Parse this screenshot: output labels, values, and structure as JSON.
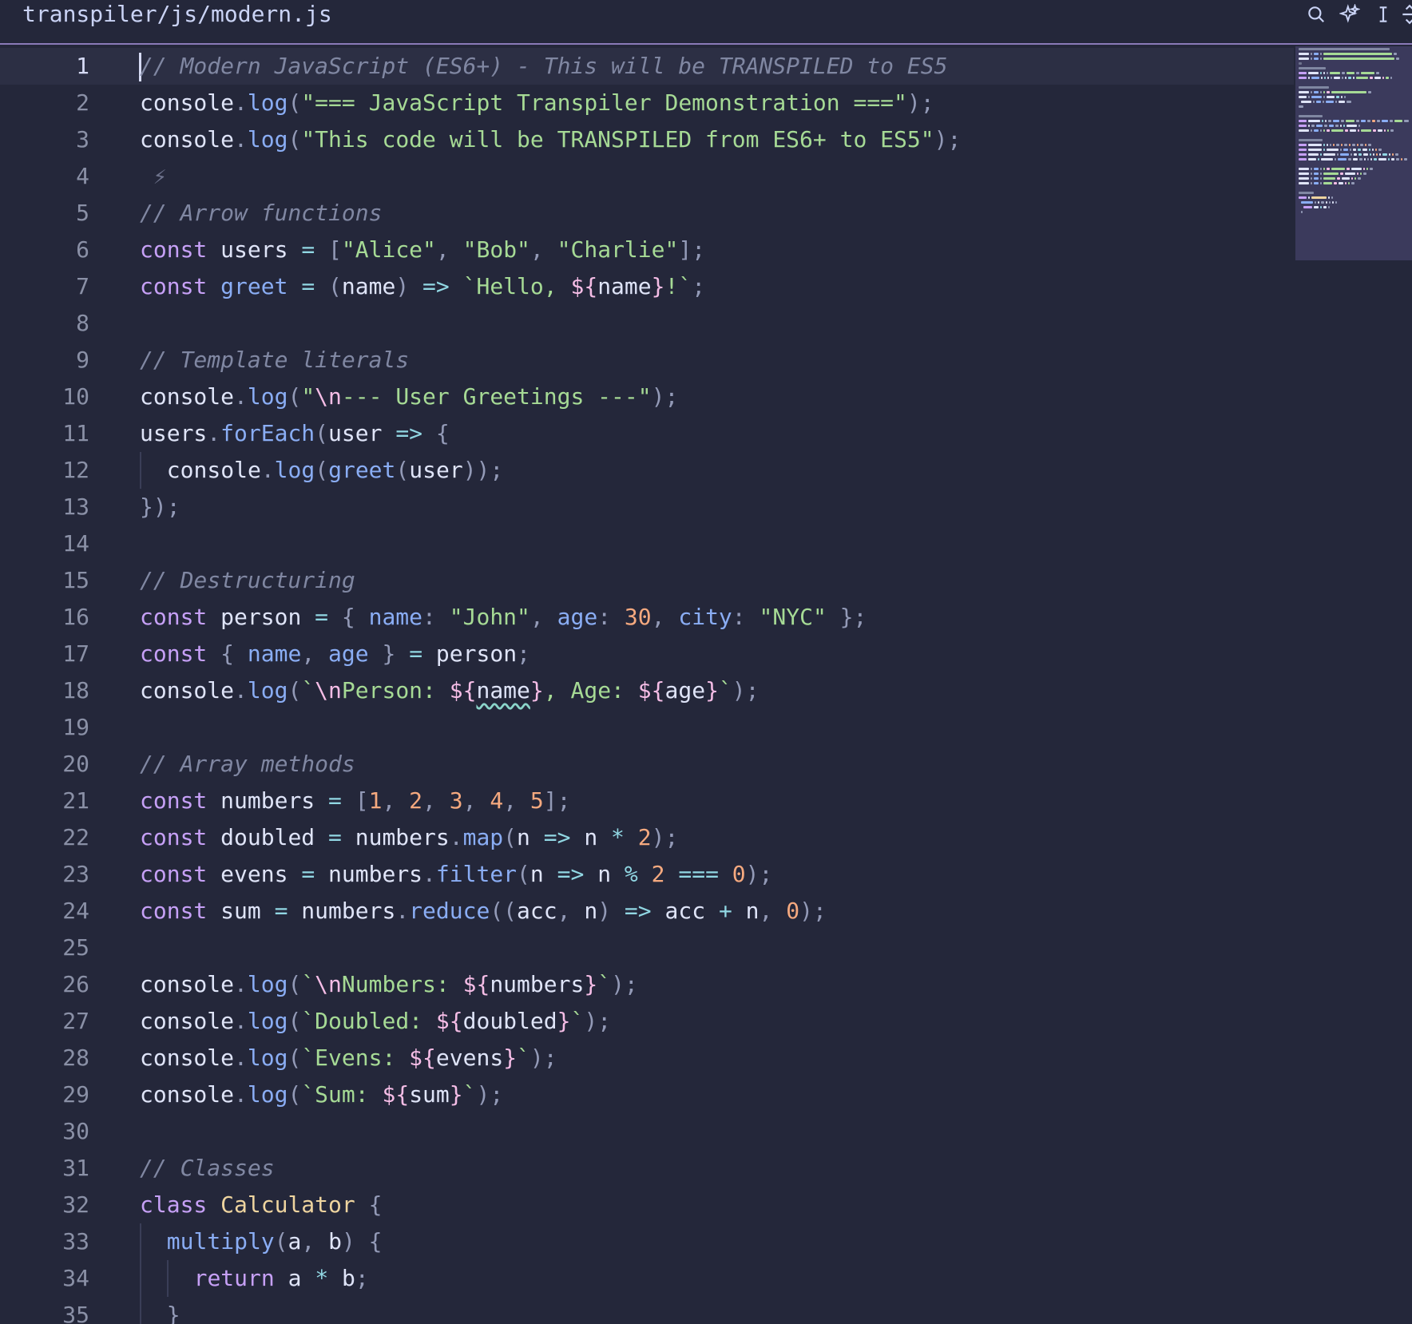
{
  "header": {
    "file_path": "transpiler/js/modern.js",
    "icons": [
      "search-icon",
      "sparkle-icon",
      "text-cursor-icon",
      "split-icon"
    ]
  },
  "editor": {
    "current_line": 1,
    "lines": [
      {
        "n": "1",
        "indent": 0,
        "tokens": [
          [
            "comment",
            "// Modern JavaScript (ES6+) - This will be TRANSPILED to ES5"
          ]
        ]
      },
      {
        "n": "2",
        "indent": 0,
        "tokens": [
          [
            "plain",
            "console"
          ],
          [
            "punct",
            "."
          ],
          [
            "function",
            "log"
          ],
          [
            "punct",
            "("
          ],
          [
            "string",
            "\"=== JavaScript Transpiler Demonstration ===\""
          ],
          [
            "punct",
            ");"
          ]
        ]
      },
      {
        "n": "3",
        "indent": 0,
        "tokens": [
          [
            "plain",
            "console"
          ],
          [
            "punct",
            "."
          ],
          [
            "function",
            "log"
          ],
          [
            "punct",
            "("
          ],
          [
            "string",
            "\"This code will be TRANSPILED from ES6+ to ES5\""
          ],
          [
            "punct",
            ");"
          ]
        ]
      },
      {
        "n": "4",
        "indent": 0,
        "tokens": [
          [
            "hint",
            " ⚡"
          ]
        ]
      },
      {
        "n": "5",
        "indent": 0,
        "tokens": [
          [
            "comment",
            "// Arrow functions"
          ]
        ]
      },
      {
        "n": "6",
        "indent": 0,
        "tokens": [
          [
            "keyword",
            "const"
          ],
          [
            "plain",
            " users "
          ],
          [
            "operator",
            "="
          ],
          [
            "plain",
            " "
          ],
          [
            "punct",
            "["
          ],
          [
            "string",
            "\"Alice\""
          ],
          [
            "punct",
            ", "
          ],
          [
            "string",
            "\"Bob\""
          ],
          [
            "punct",
            ", "
          ],
          [
            "string",
            "\"Charlie\""
          ],
          [
            "punct",
            "];"
          ]
        ]
      },
      {
        "n": "7",
        "indent": 0,
        "tokens": [
          [
            "keyword",
            "const"
          ],
          [
            "plain",
            " "
          ],
          [
            "function",
            "greet"
          ],
          [
            "plain",
            " "
          ],
          [
            "operator",
            "="
          ],
          [
            "plain",
            " "
          ],
          [
            "punct",
            "("
          ],
          [
            "plain",
            "name"
          ],
          [
            "punct",
            ")"
          ],
          [
            "plain",
            " "
          ],
          [
            "operator",
            "=>"
          ],
          [
            "plain",
            " "
          ],
          [
            "string",
            "`Hello, "
          ],
          [
            "interp",
            "${"
          ],
          [
            "plain",
            "name"
          ],
          [
            "interp",
            "}"
          ],
          [
            "string",
            "!`"
          ],
          [
            "punct",
            ";"
          ]
        ]
      },
      {
        "n": "8",
        "indent": 0,
        "tokens": []
      },
      {
        "n": "9",
        "indent": 0,
        "tokens": [
          [
            "comment",
            "// Template literals"
          ]
        ]
      },
      {
        "n": "10",
        "indent": 0,
        "tokens": [
          [
            "plain",
            "console"
          ],
          [
            "punct",
            "."
          ],
          [
            "function",
            "log"
          ],
          [
            "punct",
            "("
          ],
          [
            "string",
            "\""
          ],
          [
            "escape",
            "\\n"
          ],
          [
            "string",
            "--- User Greetings ---\""
          ],
          [
            "punct",
            ");"
          ]
        ]
      },
      {
        "n": "11",
        "indent": 0,
        "tokens": [
          [
            "plain",
            "users"
          ],
          [
            "punct",
            "."
          ],
          [
            "function",
            "forEach"
          ],
          [
            "punct",
            "("
          ],
          [
            "plain",
            "user "
          ],
          [
            "operator",
            "=>"
          ],
          [
            "plain",
            " "
          ],
          [
            "punct",
            "{"
          ]
        ]
      },
      {
        "n": "12",
        "indent": 1,
        "tokens": [
          [
            "plain",
            "console"
          ],
          [
            "punct",
            "."
          ],
          [
            "function",
            "log"
          ],
          [
            "punct",
            "("
          ],
          [
            "function",
            "greet"
          ],
          [
            "punct",
            "("
          ],
          [
            "plain",
            "user"
          ],
          [
            "punct",
            "));"
          ]
        ]
      },
      {
        "n": "13",
        "indent": 0,
        "tokens": [
          [
            "punct",
            "});"
          ]
        ]
      },
      {
        "n": "14",
        "indent": 0,
        "tokens": []
      },
      {
        "n": "15",
        "indent": 0,
        "tokens": [
          [
            "comment",
            "// Destructuring"
          ]
        ]
      },
      {
        "n": "16",
        "indent": 0,
        "tokens": [
          [
            "keyword",
            "const"
          ],
          [
            "plain",
            " person "
          ],
          [
            "operator",
            "="
          ],
          [
            "plain",
            " "
          ],
          [
            "punct",
            "{ "
          ],
          [
            "property",
            "name"
          ],
          [
            "punct",
            ": "
          ],
          [
            "string",
            "\"John\""
          ],
          [
            "punct",
            ", "
          ],
          [
            "property",
            "age"
          ],
          [
            "punct",
            ": "
          ],
          [
            "number",
            "30"
          ],
          [
            "punct",
            ", "
          ],
          [
            "property",
            "city"
          ],
          [
            "punct",
            ": "
          ],
          [
            "string",
            "\"NYC\""
          ],
          [
            "punct",
            " };"
          ]
        ]
      },
      {
        "n": "17",
        "indent": 0,
        "tokens": [
          [
            "keyword",
            "const"
          ],
          [
            "plain",
            " "
          ],
          [
            "punct",
            "{ "
          ],
          [
            "property",
            "name"
          ],
          [
            "punct",
            ", "
          ],
          [
            "property",
            "age"
          ],
          [
            "punct",
            " }"
          ],
          [
            "plain",
            " "
          ],
          [
            "operator",
            "="
          ],
          [
            "plain",
            " person"
          ],
          [
            "punct",
            ";"
          ]
        ]
      },
      {
        "n": "18",
        "indent": 0,
        "tokens": [
          [
            "plain",
            "console"
          ],
          [
            "punct",
            "."
          ],
          [
            "function",
            "log"
          ],
          [
            "punct",
            "("
          ],
          [
            "string",
            "`"
          ],
          [
            "escape",
            "\\n"
          ],
          [
            "string",
            "Person: "
          ],
          [
            "interp",
            "${"
          ],
          [
            "squiggle",
            "name"
          ],
          [
            "interp",
            "}"
          ],
          [
            "string",
            ", Age: "
          ],
          [
            "interp",
            "${"
          ],
          [
            "plain",
            "age"
          ],
          [
            "interp",
            "}"
          ],
          [
            "string",
            "`"
          ],
          [
            "punct",
            ");"
          ]
        ]
      },
      {
        "n": "19",
        "indent": 0,
        "tokens": []
      },
      {
        "n": "20",
        "indent": 0,
        "tokens": [
          [
            "comment",
            "// Array methods"
          ]
        ]
      },
      {
        "n": "21",
        "indent": 0,
        "tokens": [
          [
            "keyword",
            "const"
          ],
          [
            "plain",
            " numbers "
          ],
          [
            "operator",
            "="
          ],
          [
            "plain",
            " "
          ],
          [
            "punct",
            "["
          ],
          [
            "number",
            "1"
          ],
          [
            "punct",
            ", "
          ],
          [
            "number",
            "2"
          ],
          [
            "punct",
            ", "
          ],
          [
            "number",
            "3"
          ],
          [
            "punct",
            ", "
          ],
          [
            "number",
            "4"
          ],
          [
            "punct",
            ", "
          ],
          [
            "number",
            "5"
          ],
          [
            "punct",
            "];"
          ]
        ]
      },
      {
        "n": "22",
        "indent": 0,
        "tokens": [
          [
            "keyword",
            "const"
          ],
          [
            "plain",
            " doubled "
          ],
          [
            "operator",
            "="
          ],
          [
            "plain",
            " numbers"
          ],
          [
            "punct",
            "."
          ],
          [
            "function",
            "map"
          ],
          [
            "punct",
            "("
          ],
          [
            "plain",
            "n "
          ],
          [
            "operator",
            "=>"
          ],
          [
            "plain",
            " n "
          ],
          [
            "operator",
            "*"
          ],
          [
            "plain",
            " "
          ],
          [
            "number",
            "2"
          ],
          [
            "punct",
            ");"
          ]
        ]
      },
      {
        "n": "23",
        "indent": 0,
        "tokens": [
          [
            "keyword",
            "const"
          ],
          [
            "plain",
            " evens "
          ],
          [
            "operator",
            "="
          ],
          [
            "plain",
            " numbers"
          ],
          [
            "punct",
            "."
          ],
          [
            "function",
            "filter"
          ],
          [
            "punct",
            "("
          ],
          [
            "plain",
            "n "
          ],
          [
            "operator",
            "=>"
          ],
          [
            "plain",
            " n "
          ],
          [
            "operator",
            "%"
          ],
          [
            "plain",
            " "
          ],
          [
            "number",
            "2"
          ],
          [
            "plain",
            " "
          ],
          [
            "operator",
            "==="
          ],
          [
            "plain",
            " "
          ],
          [
            "number",
            "0"
          ],
          [
            "punct",
            ");"
          ]
        ]
      },
      {
        "n": "24",
        "indent": 0,
        "tokens": [
          [
            "keyword",
            "const"
          ],
          [
            "plain",
            " sum "
          ],
          [
            "operator",
            "="
          ],
          [
            "plain",
            " numbers"
          ],
          [
            "punct",
            "."
          ],
          [
            "function",
            "reduce"
          ],
          [
            "punct",
            "(("
          ],
          [
            "plain",
            "acc"
          ],
          [
            "punct",
            ", "
          ],
          [
            "plain",
            "n"
          ],
          [
            "punct",
            ")"
          ],
          [
            "plain",
            " "
          ],
          [
            "operator",
            "=>"
          ],
          [
            "plain",
            " acc "
          ],
          [
            "operator",
            "+"
          ],
          [
            "plain",
            " n"
          ],
          [
            "punct",
            ", "
          ],
          [
            "number",
            "0"
          ],
          [
            "punct",
            ");"
          ]
        ]
      },
      {
        "n": "25",
        "indent": 0,
        "tokens": []
      },
      {
        "n": "26",
        "indent": 0,
        "tokens": [
          [
            "plain",
            "console"
          ],
          [
            "punct",
            "."
          ],
          [
            "function",
            "log"
          ],
          [
            "punct",
            "("
          ],
          [
            "string",
            "`"
          ],
          [
            "escape",
            "\\n"
          ],
          [
            "string",
            "Numbers: "
          ],
          [
            "interp",
            "${"
          ],
          [
            "plain",
            "numbers"
          ],
          [
            "interp",
            "}"
          ],
          [
            "string",
            "`"
          ],
          [
            "punct",
            ");"
          ]
        ]
      },
      {
        "n": "27",
        "indent": 0,
        "tokens": [
          [
            "plain",
            "console"
          ],
          [
            "punct",
            "."
          ],
          [
            "function",
            "log"
          ],
          [
            "punct",
            "("
          ],
          [
            "string",
            "`Doubled: "
          ],
          [
            "interp",
            "${"
          ],
          [
            "plain",
            "doubled"
          ],
          [
            "interp",
            "}"
          ],
          [
            "string",
            "`"
          ],
          [
            "punct",
            ");"
          ]
        ]
      },
      {
        "n": "28",
        "indent": 0,
        "tokens": [
          [
            "plain",
            "console"
          ],
          [
            "punct",
            "."
          ],
          [
            "function",
            "log"
          ],
          [
            "punct",
            "("
          ],
          [
            "string",
            "`Evens: "
          ],
          [
            "interp",
            "${"
          ],
          [
            "plain",
            "evens"
          ],
          [
            "interp",
            "}"
          ],
          [
            "string",
            "`"
          ],
          [
            "punct",
            ");"
          ]
        ]
      },
      {
        "n": "29",
        "indent": 0,
        "tokens": [
          [
            "plain",
            "console"
          ],
          [
            "punct",
            "."
          ],
          [
            "function",
            "log"
          ],
          [
            "punct",
            "("
          ],
          [
            "string",
            "`Sum: "
          ],
          [
            "interp",
            "${"
          ],
          [
            "plain",
            "sum"
          ],
          [
            "interp",
            "}"
          ],
          [
            "string",
            "`"
          ],
          [
            "punct",
            ");"
          ]
        ]
      },
      {
        "n": "30",
        "indent": 0,
        "tokens": []
      },
      {
        "n": "31",
        "indent": 0,
        "tokens": [
          [
            "comment",
            "// Classes"
          ]
        ]
      },
      {
        "n": "32",
        "indent": 0,
        "tokens": [
          [
            "keyword",
            "class"
          ],
          [
            "plain",
            " "
          ],
          [
            "class",
            "Calculator"
          ],
          [
            "plain",
            " "
          ],
          [
            "punct",
            "{"
          ]
        ]
      },
      {
        "n": "33",
        "indent": 1,
        "tokens": [
          [
            "function",
            "multiply"
          ],
          [
            "punct",
            "("
          ],
          [
            "plain",
            "a"
          ],
          [
            "punct",
            ", "
          ],
          [
            "plain",
            "b"
          ],
          [
            "punct",
            ")"
          ],
          [
            "plain",
            " "
          ],
          [
            "punct",
            "{"
          ]
        ]
      },
      {
        "n": "34",
        "indent": 2,
        "tokens": [
          [
            "keyword",
            "return"
          ],
          [
            "plain",
            " a "
          ],
          [
            "operator",
            "*"
          ],
          [
            "plain",
            " b"
          ],
          [
            "punct",
            ";"
          ]
        ]
      },
      {
        "n": "35",
        "indent": 1,
        "tokens": [
          [
            "punct",
            "}"
          ]
        ]
      }
    ]
  }
}
